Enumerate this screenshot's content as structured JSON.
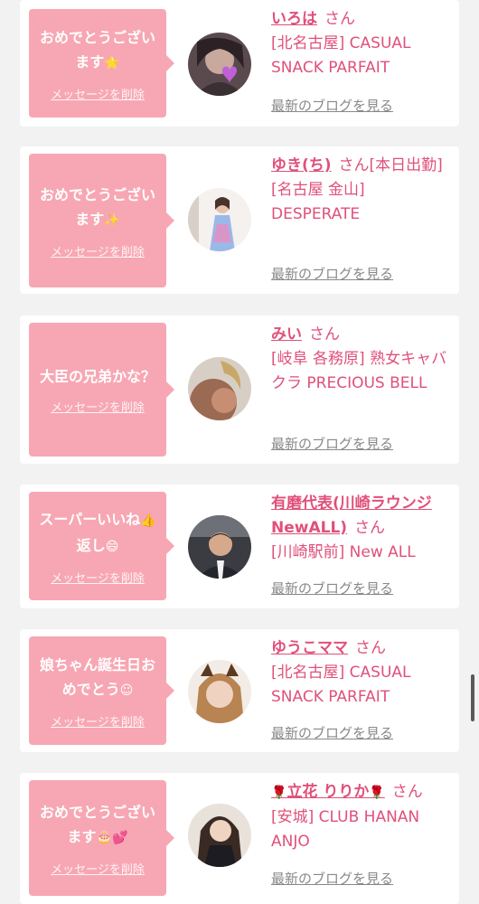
{
  "delete_label": "メッセージを削除",
  "blog_label": "最新のブログを見る",
  "honorific": "さん",
  "entries": [
    {
      "message": "おめでとうございます",
      "message_emoji": "⭐",
      "name": "いろは",
      "extra": "",
      "shop": "[北名古屋] CASUAL SNACK PARFAIT",
      "avatar_icon": "woman-heart-avatar"
    },
    {
      "message": "おめでとうございます",
      "message_emoji": "✨",
      "name": "ゆき(ち)",
      "extra": "[本日出勤]",
      "shop": "[名古屋 金山] DESPERATE",
      "avatar_icon": "woman-dress-avatar"
    },
    {
      "message": "大臣の兄弟かな？",
      "message_emoji": "",
      "name": "みい",
      "extra": "",
      "shop": "[岐阜 各務原]  熟女キャバクラ PRECIOUS BELL",
      "avatar_icon": "woman-hair-avatar"
    },
    {
      "message": "スーパーいいね",
      "message_emoji": "👍",
      "message_tail": "返し",
      "message_tail_emoji": "😄",
      "name": "有磨代表(川崎ラウンジNewALL)",
      "extra": "",
      "shop": "[川崎駅前] New ALL",
      "avatar_icon": "man-avatar"
    },
    {
      "message": "娘ちゃん誕生日おめでとう",
      "message_emoji": "☺",
      "name": "ゆうこママ",
      "extra": "",
      "shop": "[北名古屋] CASUAL SNACK PARFAIT",
      "avatar_icon": "woman-ears-avatar"
    },
    {
      "message": "おめでとうございます",
      "message_emoji": "🎂💕",
      "name_prefix_emoji": "🌹",
      "name": "立花 りりか",
      "name_suffix_emoji": "🌹",
      "extra": "",
      "shop": "[安城] CLUB HANAN ANJO",
      "avatar_icon": "woman-dark-avatar"
    }
  ],
  "colors": {
    "bubble": "#f7a7b3",
    "accent": "#e0507a",
    "background": "#f2f2f2"
  }
}
